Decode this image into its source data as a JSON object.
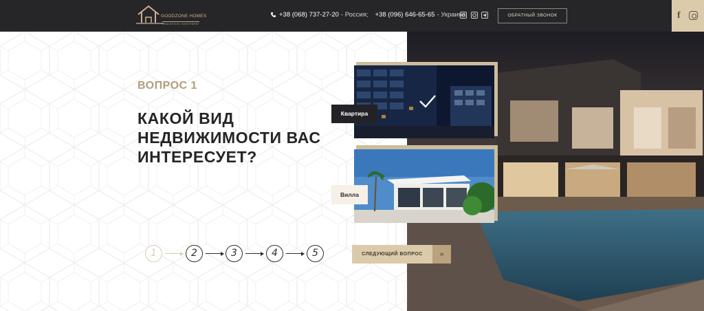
{
  "header": {
    "logo_name": "GOODZONE HOMES",
    "logo_tagline": "REALESTATE INVESTMENT",
    "phones": [
      {
        "number": "+38 (068) 737-27-20",
        "country": "- Россия;"
      },
      {
        "number": "+38 (096) 646-65-65",
        "country": "- Украина"
      }
    ],
    "messengers": [
      "viber-icon",
      "whatsapp-icon",
      "telegram-icon"
    ],
    "callback_label": "ОБРАТНЫЙ ЗВОНОК",
    "social": [
      "facebook-icon",
      "instagram-icon"
    ]
  },
  "quiz": {
    "question_number": "ВОПРОС 1",
    "question_text": "КАКОЙ ВИД НЕДВИЖИМОСТИ ВАС ИНТЕРЕСУЕТ?",
    "options": [
      {
        "label": "Квартира",
        "selected": true
      },
      {
        "label": "Вилла",
        "selected": false
      }
    ],
    "steps": [
      "1",
      "2",
      "3",
      "4",
      "5"
    ],
    "current_step": 1,
    "next_label": "СЛЕДУЮЩИЙ ВОПРОС",
    "next_arrow": "»"
  },
  "colors": {
    "header_bg": "#262528",
    "accent": "#dccbaa",
    "accent_dark": "#b29e7c",
    "text_dark": "#252525"
  }
}
